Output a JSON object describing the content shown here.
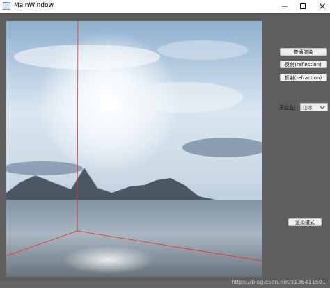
{
  "window": {
    "title": "MainWindow"
  },
  "controls": {
    "normal_render": "普通渲染",
    "reflection": "反射(reflection)",
    "refraction": "折射(refraction)",
    "skybox_label": "天空盒：",
    "skybox_value": "山水",
    "render_mode": "渲染模式"
  },
  "watermark": "https://blog.csdn.net/z136411501"
}
